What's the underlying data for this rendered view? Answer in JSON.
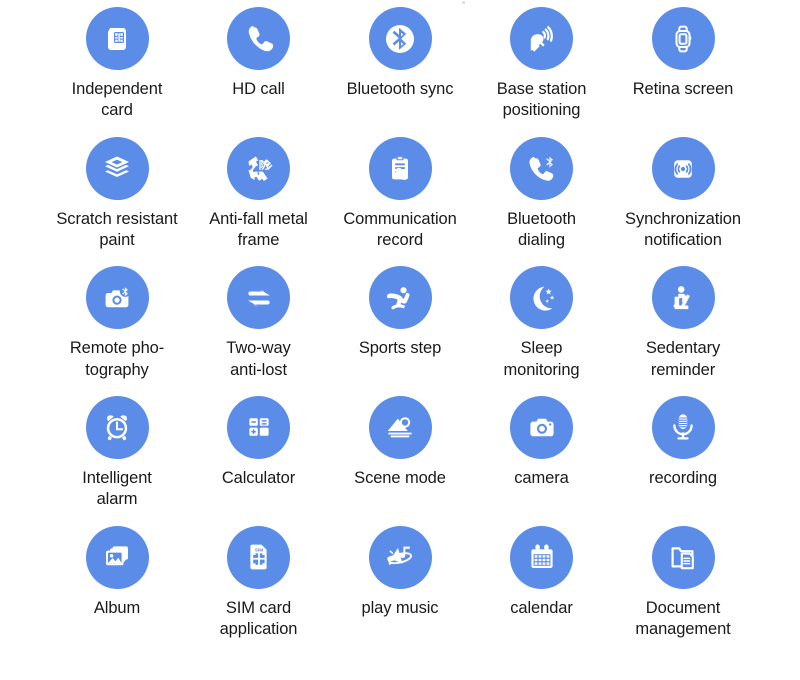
{
  "page": {
    "background_color": "#ffffff",
    "accent_color": "#5B8DE8",
    "text_color": "#1a1a1a",
    "columns": 5,
    "rows": 5
  },
  "features": [
    [
      {
        "icon": "sim-card-icon",
        "label": "Independent\ncard"
      },
      {
        "icon": "phone-handset-icon",
        "label": "HD call"
      },
      {
        "icon": "bluetooth-icon",
        "label": "Bluetooth sync"
      },
      {
        "icon": "satellite-dish-icon",
        "label": "Base station\npositioning"
      },
      {
        "icon": "smartwatch-icon",
        "label": "Retina screen"
      }
    ],
    [
      {
        "icon": "layers-icon",
        "label": "Scratch resistant\npaint"
      },
      {
        "icon": "anti-fall-recycle-icon",
        "label": "Anti-fall metal\nframe"
      },
      {
        "icon": "clipboard-phone-icon",
        "label": "Communication\nrecord"
      },
      {
        "icon": "phone-bluetooth-icon",
        "label": "Bluetooth\ndialing"
      },
      {
        "icon": "wireless-sync-icon",
        "label": "Synchronization\nnotification"
      }
    ],
    [
      {
        "icon": "camera-bluetooth-icon",
        "label": "Remote pho-\ntography"
      },
      {
        "icon": "two-way-arrows-icon",
        "label": "Two-way\nanti-lost"
      },
      {
        "icon": "running-person-icon",
        "label": "Sports step"
      },
      {
        "icon": "moon-stars-icon",
        "label": "Sleep\nmonitoring"
      },
      {
        "icon": "seated-person-icon",
        "label": "Sedentary\nreminder"
      }
    ],
    [
      {
        "icon": "alarm-clock-icon",
        "label": "Intelligent\nalarm"
      },
      {
        "icon": "calculator-icon",
        "label": "Calculator"
      },
      {
        "icon": "landscape-scene-icon",
        "label": "Scene mode"
      },
      {
        "icon": "camera-icon",
        "label": "camera"
      },
      {
        "icon": "microphone-icon",
        "label": "recording"
      }
    ],
    [
      {
        "icon": "photo-album-icon",
        "label": "Album"
      },
      {
        "icon": "sim-application-icon",
        "label": "SIM card\napplication"
      },
      {
        "icon": "music-speaker-icon",
        "label": "play music"
      },
      {
        "icon": "calendar-icon",
        "label": "calendar"
      },
      {
        "icon": "document-folder-icon",
        "label": "Document\nmanagement"
      }
    ]
  ]
}
